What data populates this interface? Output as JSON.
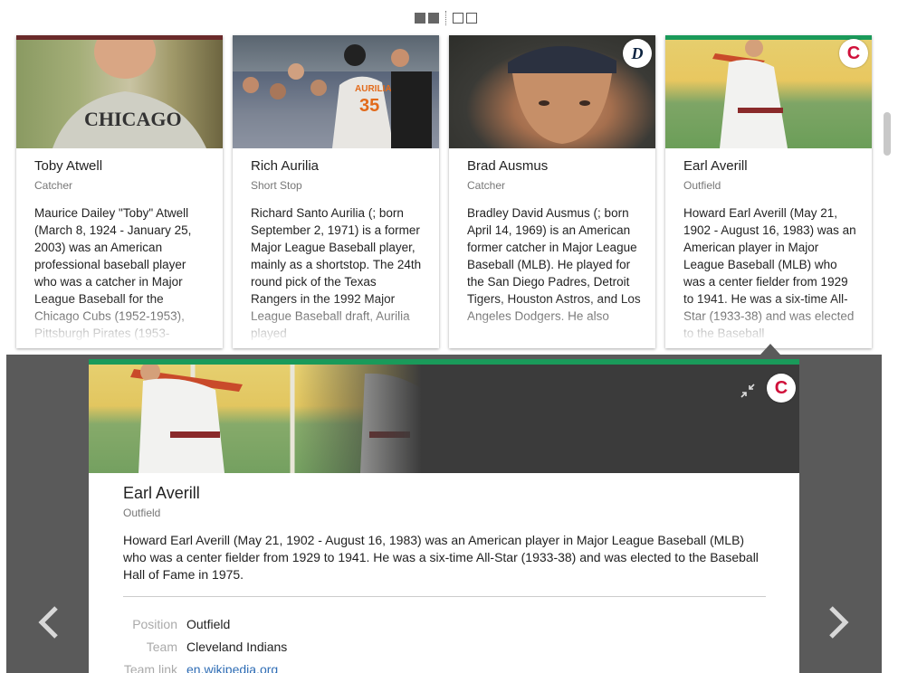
{
  "view_toggles": [
    "grid-view",
    "grid-view",
    "card-view",
    "card-view"
  ],
  "accent": "#1a9a5a",
  "team_colors": {
    "tigers": "#0c2340",
    "indians": "#d0103a",
    "cubs": "#6a2a2a"
  },
  "cards": [
    {
      "name": "Toby Atwell",
      "position": "Catcher",
      "description": "Maurice Dailey \"Toby\" Atwell (March 8, 1924 - January 25, 2003) was an American professional baseball player who was a catcher in Major League Baseball for the Chicago Cubs (1952-1953), Pittsburgh Pirates (1953-",
      "jersey_text": "CHICAGO"
    },
    {
      "name": "Rich Aurilia",
      "position": "Short Stop",
      "description": "Richard Santo Aurilia (; born September 2, 1971) is a former Major League Baseball player, mainly as a shortstop. The 24th round pick of the Texas Rangers in the 1992 Major League Baseball draft, Aurilia played",
      "jersey_text": "AURILIA",
      "jersey_number": "35"
    },
    {
      "name": "Brad Ausmus",
      "position": "Catcher",
      "description": "Bradley David Ausmus (; born April 14, 1969) is an American former catcher in Major League Baseball (MLB). He played for the San Diego Padres, Detroit Tigers, Houston Astros, and Los Angeles Dodgers. He also",
      "badge": "D"
    },
    {
      "name": "Earl Averill",
      "position": "Outfield",
      "description": "Howard Earl Averill (May 21, 1902 - August 16, 1983) was an American player in Major League Baseball (MLB) who was a center fielder from 1929 to 1941. He was a six-time All-Star (1933-38) and was elected to the Baseball",
      "badge": "C"
    }
  ],
  "detail": {
    "name": "Earl Averill",
    "position": "Outfield",
    "description": "Howard Earl Averill (May 21, 1902 - August 16, 1983) was an American player in Major League Baseball (MLB) who was a center fielder from 1929 to 1941. He was a six-time All-Star (1933-38) and was elected to the Baseball Hall of Fame in 1975.",
    "badge": "C",
    "facts": [
      {
        "label": "Position",
        "value": "Outfield"
      },
      {
        "label": "Team",
        "value": "Cleveland Indians"
      },
      {
        "label": "Team link",
        "value": "en.wikipedia.org"
      }
    ]
  }
}
